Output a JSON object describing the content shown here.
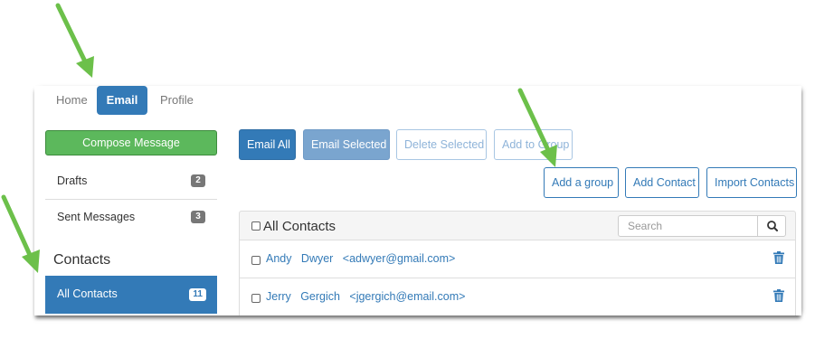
{
  "nav": {
    "tabs": [
      {
        "label": "Home",
        "active": false
      },
      {
        "label": "Email",
        "active": true
      },
      {
        "label": "Profile",
        "active": false
      }
    ]
  },
  "sidebar": {
    "compose_label": "Compose Message",
    "items": [
      {
        "label": "Drafts",
        "count": "2"
      },
      {
        "label": "Sent Messages",
        "count": "3"
      }
    ],
    "contacts_heading": "Contacts",
    "active_item": {
      "label": "All Contacts",
      "count": "11"
    }
  },
  "toolbar": {
    "email_all": "Email All",
    "email_selected": "Email Selected",
    "delete_selected": "Delete Selected",
    "add_to_group": "Add to Group"
  },
  "actions": {
    "add_group": "Add a group",
    "add_contact": "Add Contact",
    "import_contacts": "Import Contacts"
  },
  "contacts": {
    "title": "All Contacts",
    "search_placeholder": "Search",
    "rows": [
      {
        "first": "Andy",
        "last": "Dwyer",
        "email": "<adwyer@gmail.com>"
      },
      {
        "first": "Jerry",
        "last": "Gergich",
        "email": "<jgergich@email.com>"
      }
    ]
  },
  "colors": {
    "primary": "#337ab7",
    "success": "#5cb85c",
    "annotation_arrow": "#6cc04a"
  }
}
